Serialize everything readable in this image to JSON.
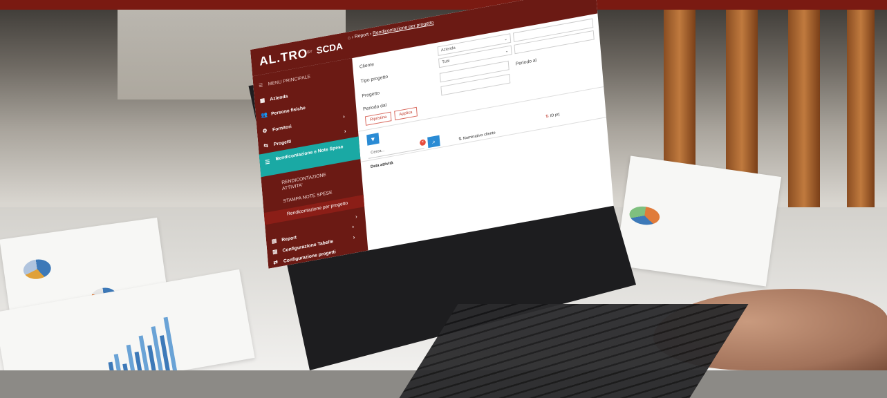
{
  "app": {
    "logo": "AL.TRO",
    "logo_by": "BY",
    "logo_brand": "SCDA"
  },
  "breadcrumb": {
    "home_icon": "home-icon",
    "level1": "Report",
    "level2": "Rendicontazione per progetto"
  },
  "sidebar": {
    "heading": "MENU PRINCIPALE",
    "items": [
      {
        "label": "Azienda",
        "icon": "building-icon"
      },
      {
        "label": "Persone fisiche",
        "icon": "people-icon"
      },
      {
        "label": "Fornitori",
        "icon": "supplier-icon"
      },
      {
        "label": "Progetti",
        "icon": "project-icon"
      },
      {
        "label": "Rendicontazione e Note Spese",
        "icon": "list-icon"
      },
      {
        "label": "Report",
        "icon": "document-icon"
      },
      {
        "label": "Configurazione Tabelle",
        "icon": "table-icon"
      },
      {
        "label": "Configurazione progetti",
        "icon": "config-icon"
      }
    ],
    "sub_items": [
      {
        "label": "RENDICONTAZIONE ATTIVITA'"
      },
      {
        "label": "STAMPA NOTE SPESE"
      },
      {
        "label": "Rendicontazione per progetto"
      }
    ]
  },
  "form": {
    "cliente_label": "Cliente",
    "tipo_progetto_label": "Tipo progetto",
    "progetto_label": "Progetto",
    "periodo_dal_label": "Periodo dal",
    "periodo_al_label": "Periodo al",
    "azienda_value": "Azienda",
    "tipo_value": "Tutti",
    "ripristina_label": "Ripristina",
    "applica_label": "Applica"
  },
  "grid": {
    "search_placeholder": "Cerca...",
    "columns": [
      "Nominativo cliente",
      "ID prj",
      "Data attività"
    ]
  },
  "colors": {
    "brand": "#6b1a14",
    "accent": "#1aa9a4",
    "button_blue": "#2a8bd4"
  }
}
